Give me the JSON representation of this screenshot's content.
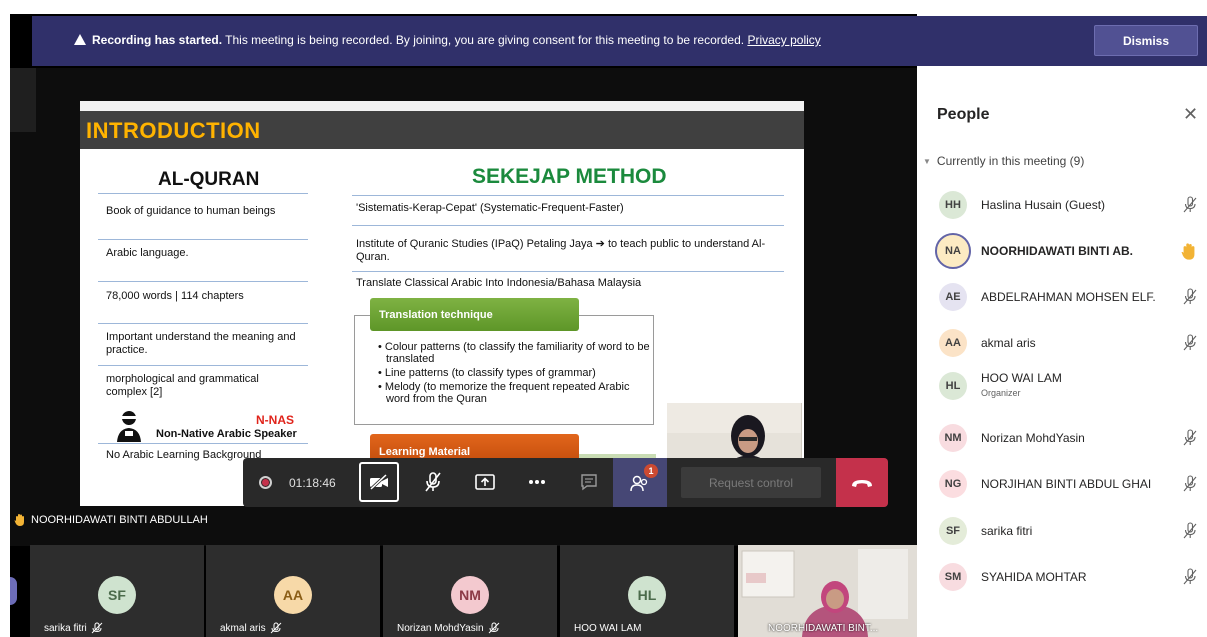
{
  "banner": {
    "bold_text": "Recording has started.",
    "text": " This meeting is being recorded. By joining, you are giving consent for this meeting to be recorded. ",
    "link": "Privacy policy",
    "dismiss": "Dismiss"
  },
  "slide": {
    "title": "INTRODUCTION",
    "left_title": "AL-QURAN",
    "right_title": "SEKEJAP METHOD",
    "left_items": [
      "Book of guidance to human beings",
      "Arabic language.",
      "78,000 words | 114 chapters",
      "Important understand the meaning and practice.",
      "morphological and grammatical complex [2]",
      "No Arabic Learning Background"
    ],
    "right_items": [
      "'Sistematis-Kerap-Cepat' (Systematic-Frequent-Faster)",
      "Institute of Quranic Studies (IPaQ) Petaling Jaya ➔ to teach public to understand Al-Quran.",
      "Translate Classical Arabic Into Indonesia/Bahasa Malaysia"
    ],
    "translation_head": "Translation technique",
    "translation_bullets": [
      "• Colour patterns (to classify the familiarity of word to be translated",
      "• Line patterns (to classify types of grammar)",
      "• Melody (to memorize the frequent repeated Arabic word from the Quran"
    ],
    "learning_head": "Learning Material",
    "nnas_title": "N-NAS",
    "nnas_sub": "Non-Native Arabic Speaker"
  },
  "controls": {
    "timer": "01:18:46",
    "people_badge": "1",
    "request_control": "Request control"
  },
  "presenter_label": "NOORHIDAWATI BINTI ABDULLAH",
  "tiles": [
    {
      "initials": "SF",
      "name": "sarika fitri",
      "color": "#cfe3cf"
    },
    {
      "initials": "AA",
      "name": "akmal aris",
      "color": "#f7d9a8"
    },
    {
      "initials": "NM",
      "name": "Norizan MohdYasin",
      "color": "#f3c9cf"
    },
    {
      "initials": "HL",
      "name": "HOO WAI LAM",
      "color": "#cfe3cf"
    }
  ],
  "video_tile_name": "NOORHIDAWATI BINT...",
  "people": {
    "title": "People",
    "section": "Currently in this meeting (9)",
    "list": [
      {
        "initials": "HH",
        "name": "Haslina Husain (Guest)",
        "sub": "",
        "color": "#dbe8d6",
        "mic": "muted"
      },
      {
        "initials": "NA",
        "name": "NOORHIDAWATI BINTI AB.",
        "sub": "",
        "color": "#fcebc3",
        "mic": "hand"
      },
      {
        "initials": "AE",
        "name": "ABDELRAHMAN MOHSEN ELF.",
        "sub": "",
        "color": "#e5e3f1",
        "mic": "muted"
      },
      {
        "initials": "AA",
        "name": "akmal aris",
        "sub": "",
        "color": "#fbe3c7",
        "mic": "muted"
      },
      {
        "initials": "HL",
        "name": "HOO WAI LAM",
        "sub": "Organizer",
        "color": "#dbe8d6",
        "mic": "none"
      },
      {
        "initials": "NM",
        "name": "Norizan MohdYasin",
        "sub": "",
        "color": "#f8dce0",
        "mic": "muted"
      },
      {
        "initials": "NG",
        "name": "NORJIHAN BINTI ABDUL GHAI",
        "sub": "",
        "color": "#fbdde0",
        "mic": "muted"
      },
      {
        "initials": "SF",
        "name": "sarika fitri",
        "sub": "",
        "color": "#e4ecd9",
        "mic": "muted"
      },
      {
        "initials": "SM",
        "name": "SYAHIDA MOHTAR",
        "sub": "",
        "color": "#f8dce0",
        "mic": "muted"
      }
    ]
  },
  "colors": {
    "accent": "#6264a7",
    "banner": "#30306a",
    "hangup": "#c4314b",
    "sekejap": "#1b8a3d",
    "intro": "#ffb300"
  }
}
